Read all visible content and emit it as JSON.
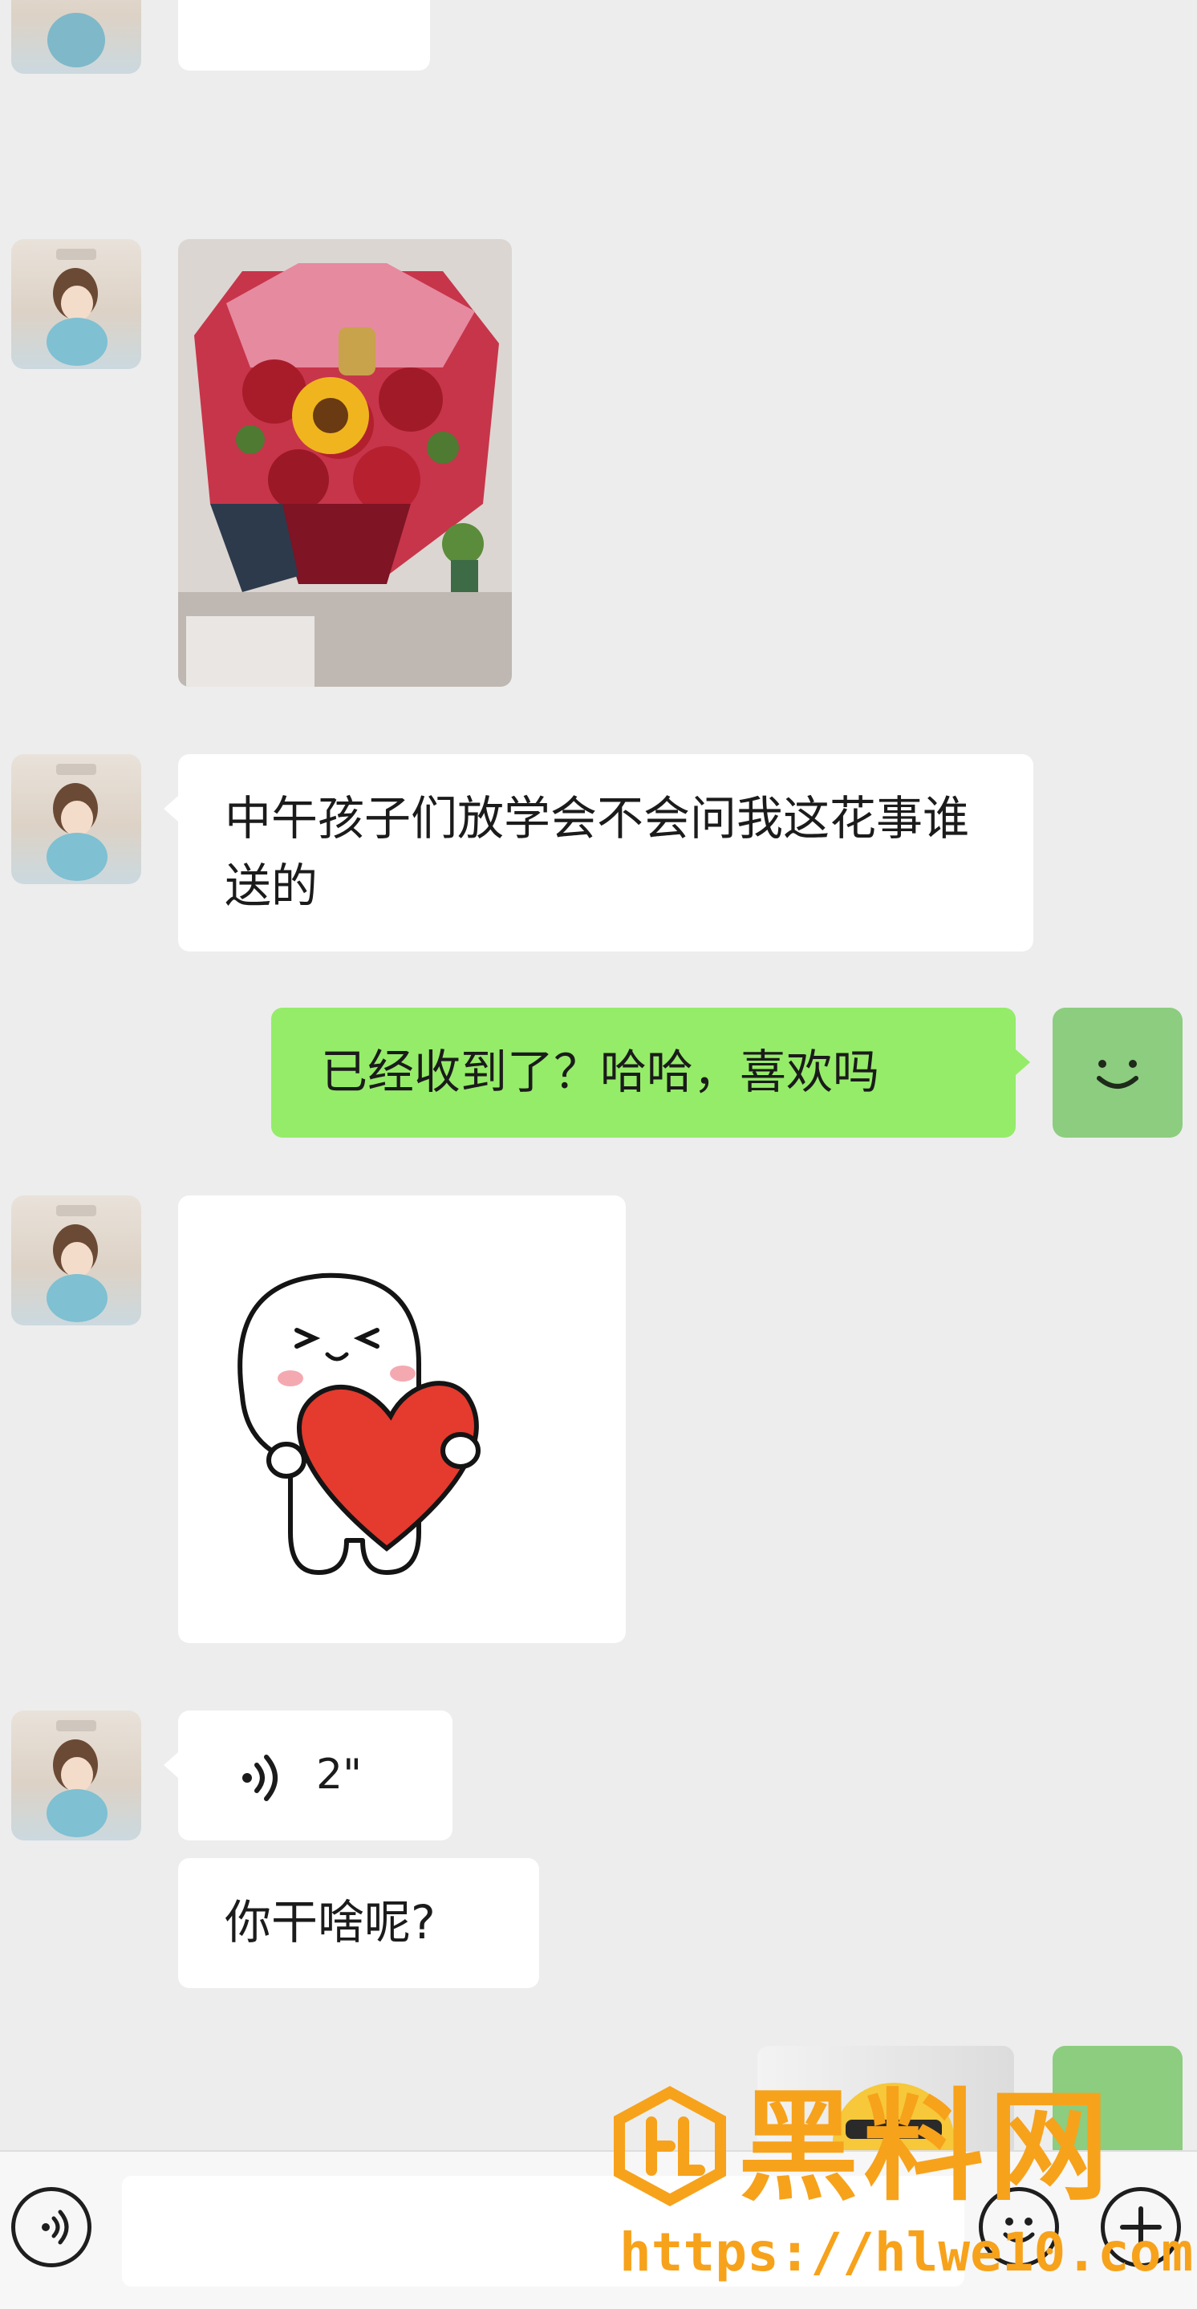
{
  "messages": {
    "m2_text": "中午孩子们放学会不会问我这花事谁送的",
    "m3_text": "已经收到了？哈哈，喜欢吗",
    "m5_duration": "2\"",
    "m6_text": "你干啥呢?"
  },
  "icons": {
    "voice": "voice-wave-icon",
    "emoji": "smiley-icon",
    "plus": "plus-icon",
    "voice_toggle": "voice-toggle-icon"
  },
  "colors": {
    "background": "#ededed",
    "incoming_bubble": "#ffffff",
    "outgoing_bubble": "#95ec69",
    "input_bar": "#f7f7f7",
    "watermark": "#f7a21b"
  },
  "watermark": {
    "title": "黑料网",
    "url": "https://hlwe10.com"
  }
}
